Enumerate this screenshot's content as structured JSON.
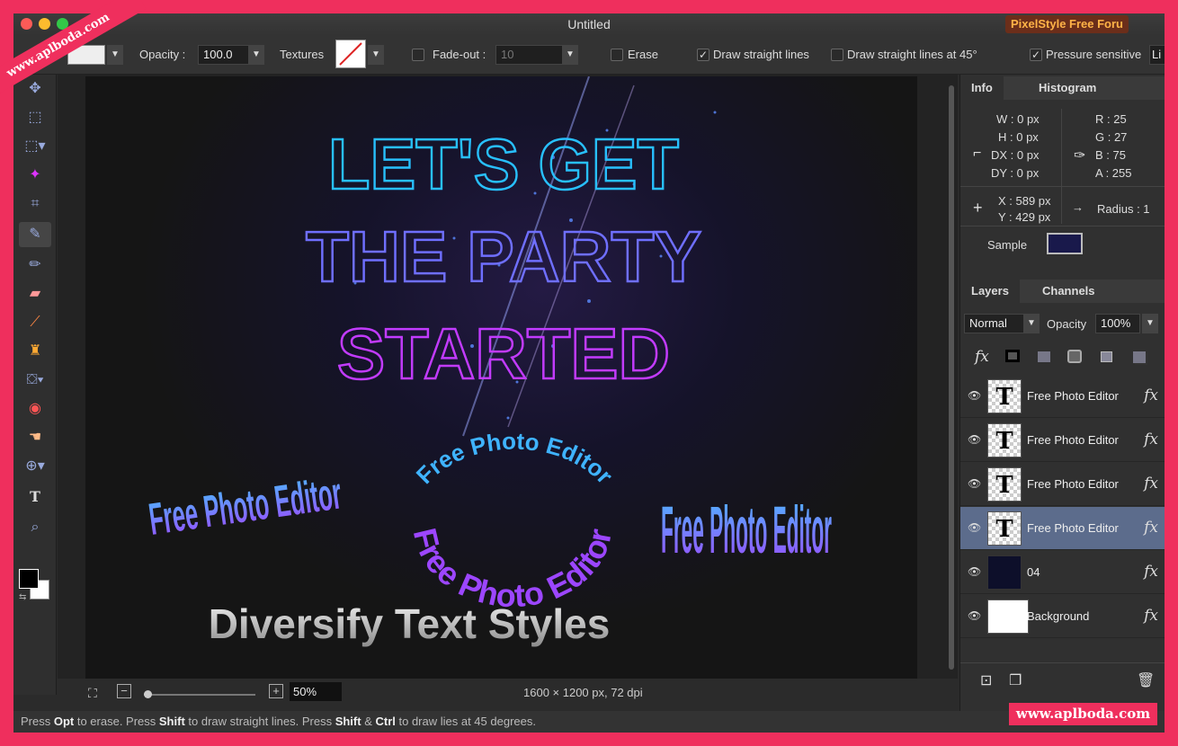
{
  "window": {
    "title": "Untitled",
    "brand": "PixelStyle Free Foru"
  },
  "toolbar": {
    "opacity_label": "Opacity :",
    "opacity_value": "100.0",
    "textures_label": "Textures",
    "fadeout_label": "Fade-out :",
    "fadeout_value": "10",
    "erase_label": "Erase",
    "straight_label": "Draw straight lines",
    "straight45_label": "Draw straight lines at 45°",
    "pressure_label": "Pressure sensitive",
    "cut_label": "Li"
  },
  "canvas": {
    "line1": "LET'S GET",
    "line2": "THE PARTY",
    "line3": "STARTED",
    "arc_text": "Free Photo Editor",
    "caption": "Diversify Text Styles"
  },
  "zoom": {
    "value": "50%",
    "doc_size": "1600 × 1200 px, 72 dpi"
  },
  "status": {
    "p1": "Press ",
    "k1": "Opt",
    "p2": " to erase. Press ",
    "k2": "Shift",
    "p3": " to draw straight lines. Press ",
    "k3": "Shift",
    "p4": " & ",
    "k4": "Ctrl",
    "p5": " to draw lies at 45 degrees."
  },
  "info_panel": {
    "tab_info": "Info",
    "tab_histogram": "Histogram",
    "w": "W :  0 px",
    "h": "H :  0 px",
    "dx": "DX :  0 px",
    "dy": "DY :  0 px",
    "r": "R :   25",
    "g": "G :   27",
    "b": "B :   75",
    "a": "A :   255",
    "x": "X :  589 px",
    "y": "Y :  429 px",
    "radius": "Radius :  1",
    "sample_label": "Sample",
    "sample_color": "#19194b"
  },
  "layers_panel": {
    "tab_layers": "Layers",
    "tab_channels": "Channels",
    "blend_mode": "Normal",
    "opacity_label": "Opacity",
    "opacity_value": "100%",
    "fx": "fx",
    "layers": [
      {
        "name": "Free Photo Editor",
        "type": "text",
        "selected": false
      },
      {
        "name": "Free Photo Editor",
        "type": "text",
        "selected": false
      },
      {
        "name": "Free Photo Editor",
        "type": "text",
        "selected": false
      },
      {
        "name": "Free Photo Editor",
        "type": "text",
        "selected": true
      },
      {
        "name": "04",
        "type": "image",
        "selected": false
      },
      {
        "name": "Background",
        "type": "fill",
        "selected": false
      }
    ]
  },
  "watermark": {
    "top": "www.aplboda.com",
    "bottom": "www.aplboda.com"
  }
}
